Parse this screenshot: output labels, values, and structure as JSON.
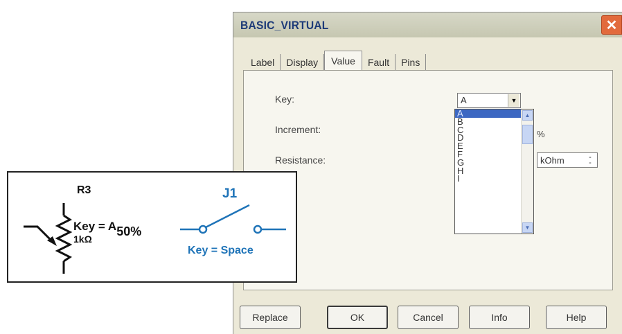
{
  "dialog": {
    "title": "BASIC_VIRTUAL",
    "close_glyph": "✕",
    "tabs": [
      "Label",
      "Display",
      "Value",
      "Fault",
      "Pins"
    ],
    "active_tab": "Value",
    "fields": {
      "key_label": "Key:",
      "increment_label": "Increment:",
      "resistance_label": "Resistance:"
    },
    "key_combo": {
      "value": "A"
    },
    "key_options": [
      "A",
      "B",
      "C",
      "D",
      "E",
      "F",
      "G",
      "H",
      "I"
    ],
    "increment_unit": "%",
    "resistance_unit": "kOhm",
    "buttons": {
      "replace": "Replace",
      "ok": "OK",
      "cancel": "Cancel",
      "info": "Info",
      "help": "Help"
    }
  },
  "schematic": {
    "resistor_ref": "R3",
    "resistor_key_prefix": "Key = A",
    "resistor_key_percent": "50%",
    "resistor_value": "1kΩ",
    "switch_ref": "J1",
    "switch_key": "Key = Space",
    "colors": {
      "resistor": "#111111",
      "switch": "#1f74b8"
    }
  }
}
